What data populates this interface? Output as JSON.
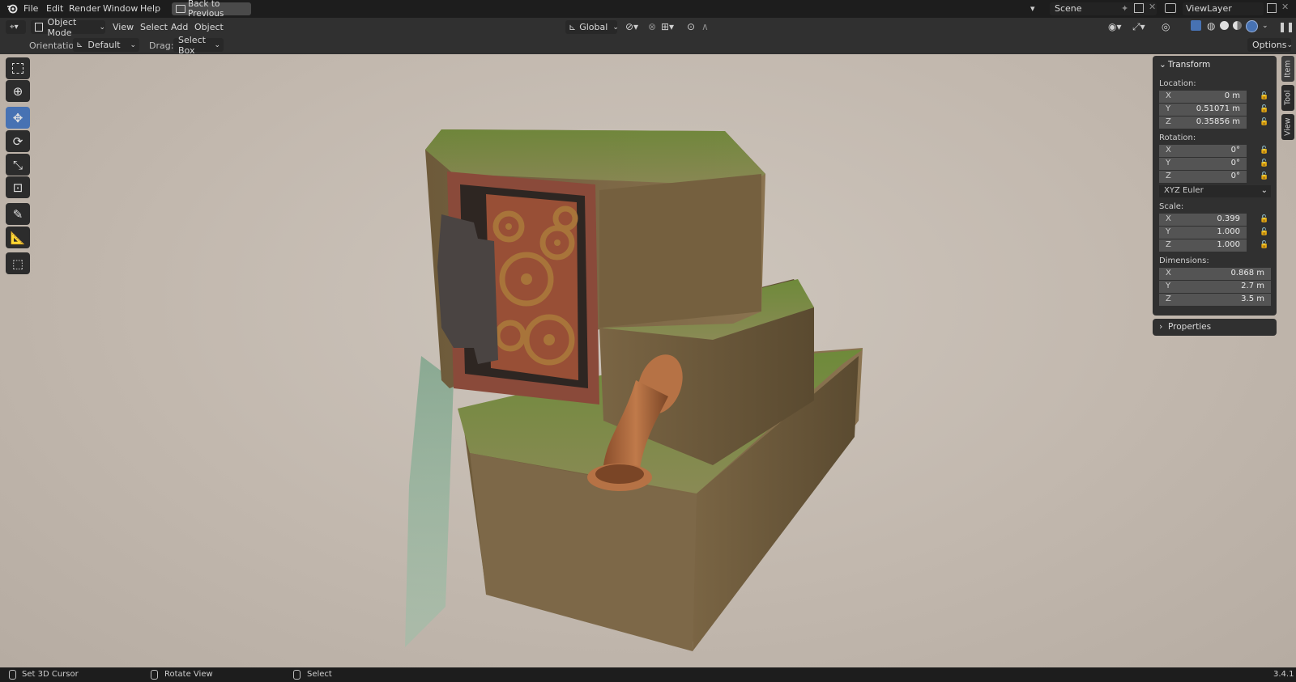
{
  "menu": {
    "items": [
      "File",
      "Edit",
      "Render",
      "Window",
      "Help"
    ],
    "back_button": "Back to Previous"
  },
  "scene": {
    "name": "Scene",
    "view_layer": "ViewLayer"
  },
  "header": {
    "mode": "Object Mode",
    "menus": [
      "View",
      "Select",
      "Add",
      "Object"
    ],
    "transform_orientation": "Global"
  },
  "tool_settings": {
    "orientation_label": "Orientation:",
    "orientation_value": "Default",
    "drag_label": "Drag:",
    "drag_value": "Select Box",
    "options_label": "Options"
  },
  "toolbar": {
    "active_tool": "move"
  },
  "npanel": {
    "transform_title": "Transform",
    "location_label": "Location:",
    "location": [
      {
        "axis": "X",
        "value": "0 m"
      },
      {
        "axis": "Y",
        "value": "0.51071 m"
      },
      {
        "axis": "Z",
        "value": "0.35856 m"
      }
    ],
    "rotation_label": "Rotation:",
    "rotation": [
      {
        "axis": "X",
        "value": "0°"
      },
      {
        "axis": "Y",
        "value": "0°"
      },
      {
        "axis": "Z",
        "value": "0°"
      }
    ],
    "rotation_mode": "XYZ Euler",
    "scale_label": "Scale:",
    "scale": [
      {
        "axis": "X",
        "value": "0.399"
      },
      {
        "axis": "Y",
        "value": "1.000"
      },
      {
        "axis": "Z",
        "value": "1.000"
      }
    ],
    "dimensions_label": "Dimensions:",
    "dimensions": [
      {
        "axis": "X",
        "value": "0.868 m"
      },
      {
        "axis": "Y",
        "value": "2.7 m"
      },
      {
        "axis": "Z",
        "value": "3.5 m"
      }
    ],
    "properties_title": "Properties"
  },
  "side_tabs": [
    "Item",
    "Tool",
    "View"
  ],
  "status": {
    "items": [
      "Set 3D Cursor",
      "Rotate View",
      "Select"
    ],
    "version": "3.4.1"
  },
  "colors": {
    "accent": "#4772b3",
    "panel": "#303030",
    "viewport_bg": "#c5bbb1"
  }
}
